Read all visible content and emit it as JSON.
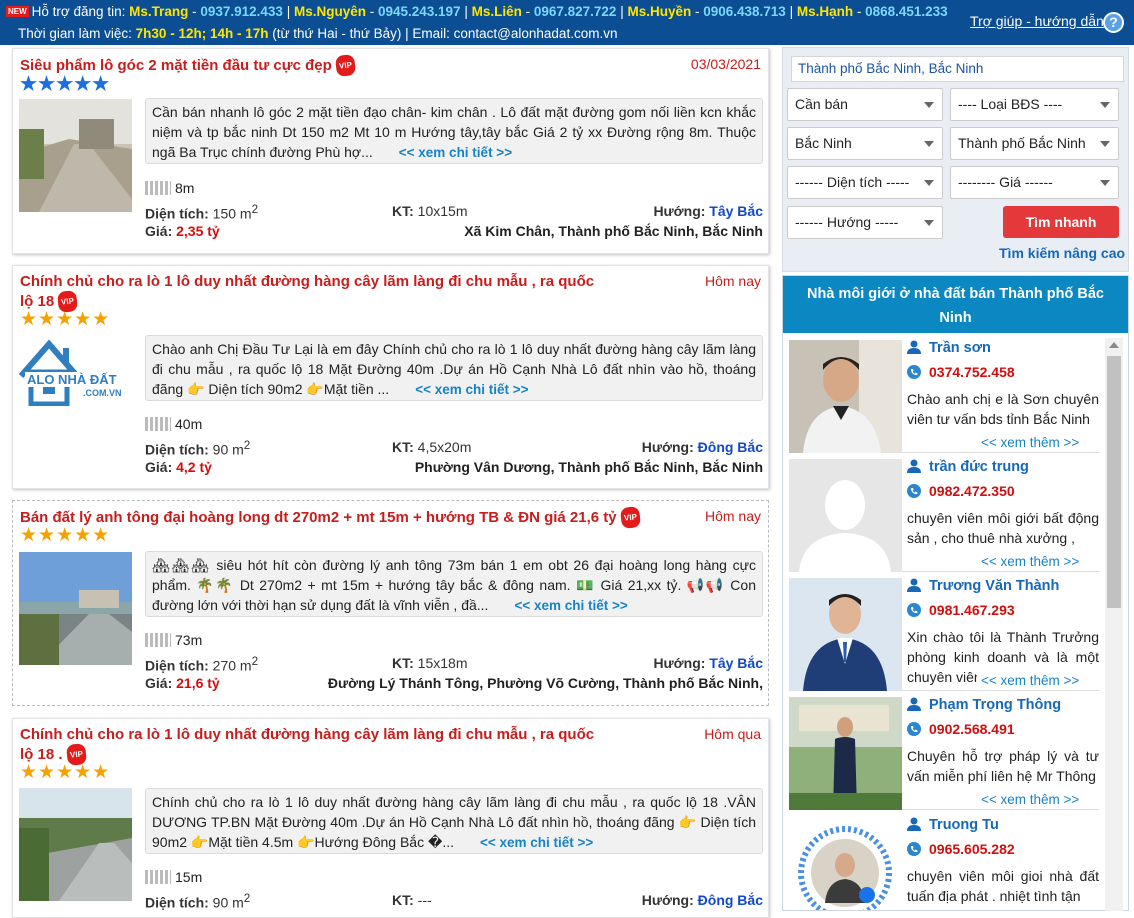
{
  "topbar": {
    "new_badge": "NEW",
    "support_label": "Hỗ trợ đăng tin:",
    "contacts": [
      {
        "name": "Ms.Trang",
        "phone": "0937.912.433"
      },
      {
        "name": "Ms.Nguyên",
        "phone": "0945.243.197"
      },
      {
        "name": "Ms.Liên",
        "phone": "0967.827.722"
      },
      {
        "name": "Ms.Huyền",
        "phone": "0906.438.713"
      },
      {
        "name": "Ms.Hạnh",
        "phone": "0868.451.233"
      }
    ],
    "hours_label": "Thời gian làm việc:",
    "hours": "7h30 - 12h; 14h - 17h",
    "hours_days": "(từ thứ Hai - thứ Bảy) | Email: contact@alonhadat.com.vn",
    "help_link": "Trợ giúp - hướng dẫn",
    "help_icon": "?"
  },
  "listings": [
    {
      "title": "Siêu phẩm lô góc 2 mặt tiền đầu tư cực đẹp",
      "vip": "VIP",
      "date": "03/03/2021",
      "stars": "★★★★★",
      "description": "Cần bán nhanh lô góc 2 mặt tiền đạo chân- kim chân . Lô đất mặt đường gom nối liền kcn khắc niệm và tp bắc ninh Dt 150 m2 Mt 10 m Hướng tây,tây bắc Giá 2 tỷ xx Đường rộng 8m. Thuộc ngã Ba Trục chính đường Phù hợ...",
      "more": "<< xem chi tiết >>",
      "road_width": "8m",
      "area_label": "Diện tích:",
      "area_value": "150 m",
      "area_sup": "2",
      "kt_label": "KT:",
      "kt_value": "10x15m",
      "direction_label": "Hướng:",
      "direction": "Tây Bắc",
      "price_label": "Giá:",
      "price": "2,35 tỷ",
      "address": "Xã Kim Chân, Thành phố Bắc Ninh, Bắc Ninh"
    },
    {
      "title": "Chính chủ cho ra lò 1 lô duy nhất đường hàng cây lãm làng đi chu mẫu , ra quốc lộ 18",
      "vip": "VIP",
      "date": "Hôm nay",
      "stars": "★★★★★",
      "description": "Chào anh Chị Đầu Tư Lại là em đây Chính chủ cho ra lò 1 lô duy nhất đường hàng cây lãm làng đi chu mẫu , ra quốc lộ 18 Mặt Đường 40m .Dự án Hồ Cạnh Nhà Lô đất nhìn vào hồ, thoáng đãng 👉 Diện tích 90m2 👉Mặt tiền ...",
      "more": "<< xem chi tiết >>",
      "thumb_logo": "ALO NHÀ ĐẤT",
      "thumb_sub": ".COM.VN",
      "road_width": "40m",
      "area_label": "Diện tích:",
      "area_value": "90 m",
      "area_sup": "2",
      "kt_label": "KT:",
      "kt_value": "4,5x20m",
      "direction_label": "Hướng:",
      "direction": "Đông Bắc",
      "price_label": "Giá:",
      "price": "4,2 tỷ",
      "address": "Phường Vân Dương, Thành phố Bắc Ninh, Bắc Ninh"
    },
    {
      "title": "Bán đất lý anh tông đại hoàng long dt 270m2 + mt 15m + hướng TB & ĐN giá 21,6 tỷ",
      "vip": "VIP",
      "date": "Hôm nay",
      "stars": "★★★★★",
      "description": "🏘🏘🏘 siêu hót hít còn đường lý anh tông 73m bán 1 em obt 26 đại hoàng long hàng cực phẩm. 🌴🌴 Dt 270m2 + mt 15m + hướng tây bắc & đông nam. 💵 Giá 21,xx tỷ. 📢📢 Con đường lớn với thời hạn sử dụng đất là vĩnh viễn , đầ...",
      "more": "<< xem chi tiết >>",
      "road_width": "73m",
      "area_label": "Diện tích:",
      "area_value": "270 m",
      "area_sup": "2",
      "kt_label": "KT:",
      "kt_value": "15x18m",
      "direction_label": "Hướng:",
      "direction": "Tây Bắc",
      "price_label": "Giá:",
      "price": "21,6 tỷ",
      "address": "Đường Lý Thánh Tông, Phường Võ Cường, Thành phố Bắc Ninh,"
    },
    {
      "title": "Chính chủ cho ra lò 1 lô duy nhất đường hàng cây lãm làng đi chu mẫu , ra quốc lộ 18 .",
      "vip": "VIP",
      "date": "Hôm qua",
      "stars": "★★★★★",
      "description": "Chính chủ cho ra lò 1 lô duy nhất đường hàng cây lãm làng đi chu mẫu , ra quốc lộ 18 .VÂN DƯƠNG TP.BN Mặt Đường 40m .Dự án Hồ Cạnh Nhà Lô đất nhìn hồ, thoáng đãng 👉 Diện tích 90m2 👉Mặt tiền 4.5m 👉Hướng Đông Bắc �...",
      "more": "<< xem chi tiết >>",
      "road_width": "15m",
      "area_label": "Diện tích:",
      "area_value": "90 m",
      "area_sup": "2",
      "kt_label": "KT:",
      "kt_value": "---",
      "direction_label": "Hướng:",
      "direction": "Đông Bắc"
    }
  ],
  "search": {
    "location": "Thành phố Bắc Ninh, Bắc Ninh",
    "transaction": "Cần bán",
    "type": "---- Loại BĐS ----",
    "province": "Bắc Ninh",
    "district": "Thành phố Bắc Ninh",
    "area": "------ Diện tích -----",
    "price": "-------- Giá ------",
    "direction": "------ Hướng -----",
    "button": "Tìm nhanh",
    "advanced": "Tìm kiếm nâng cao"
  },
  "brokers": {
    "heading": "Nhà môi giới ở nhà đất bán Thành phố Bắc Ninh",
    "more": "<< xem thêm >>",
    "items": [
      {
        "name": "Trần sơn",
        "phone": "0374.752.458",
        "desc": "Chào anh chị e là Sơn chuyên viên tư vấn bds tỉnh Bắc Ninh"
      },
      {
        "name": "trần đức trung",
        "phone": "0982.472.350",
        "desc": "chuyên viên môi giới bất động sản , cho thuê nhà xưởng ,"
      },
      {
        "name": "Trương Văn Thành",
        "phone": "0981.467.293",
        "desc": "Xin chào tôi là Thành Trưởng phòng kinh doanh và là một chuyên viên"
      },
      {
        "name": "Phạm Trọng Thông",
        "phone": "0902.568.491",
        "desc": "Chuyên hỗ trợ pháp lý và tư vấn miễn phí liên hệ Mr Thông"
      },
      {
        "name": "Truong Tu",
        "phone": "0965.605.282",
        "desc": "chuyên viên môi gioi nhà đất tuấn địa phát . nhiệt tình tận"
      }
    ]
  }
}
